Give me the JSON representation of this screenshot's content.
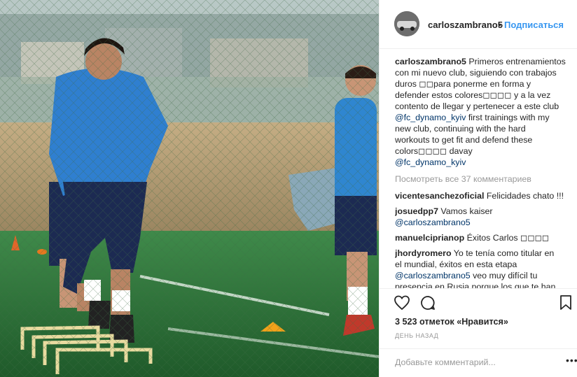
{
  "post": {
    "username": "carloszambrano5",
    "dot": "•",
    "follow_label": "Подписаться",
    "caption_lines": [
      "Primeros entrenamientos",
      "con mi nuevo club, siguiendo con trabajos",
      "duros ◻◻para ponerme en forma y",
      "defender estos colores◻◻◻◻ y a la vez",
      "contento de llegar y pertenecer a este club"
    ],
    "caption_mention_1": "@fc_dynamo_kyiv",
    "caption_after_mention_1": " first trainings with my",
    "caption_lines_2": [
      "new club, continuing with the hard",
      "workouts to get fit and defend these",
      "colors◻◻◻◻ davay"
    ],
    "caption_mention_2": "@fc_dynamo_kyiv",
    "view_all_label": "Посмотреть все 37 комментариев",
    "comments": [
      {
        "user": "vicentesanchezoficial",
        "text": "Felicidades chato !!!"
      },
      {
        "user": "josuedpp7",
        "text": "Vamos kaiser",
        "mention": "@carloszambrano5"
      },
      {
        "user": "manuelciprianop",
        "text": "Éxitos Carlos ◻◻◻◻"
      },
      {
        "user": "jhordyromero",
        "text": "Yo te tenía como titular en",
        "lines": [
          "el mundial, éxitos en esta etapa"
        ],
        "mention": "@carloszambrano5",
        "after_mention": " veo muy difícil tu",
        "last_line": "presencia en Rusia porque los que te han"
      }
    ],
    "likes_label": "3 523 отметок «Нравится»",
    "time_label": "День назад",
    "add_comment_placeholder": "Добавьте комментарий...",
    "more_label": "•••"
  },
  "icons": {
    "like": "heart-icon",
    "comment": "comment-icon",
    "save": "bookmark-icon",
    "more": "more-options-icon"
  },
  "colors": {
    "link_blue": "#3897f0",
    "mention_blue": "#003569",
    "muted_gray": "#999999",
    "text": "#262626"
  }
}
